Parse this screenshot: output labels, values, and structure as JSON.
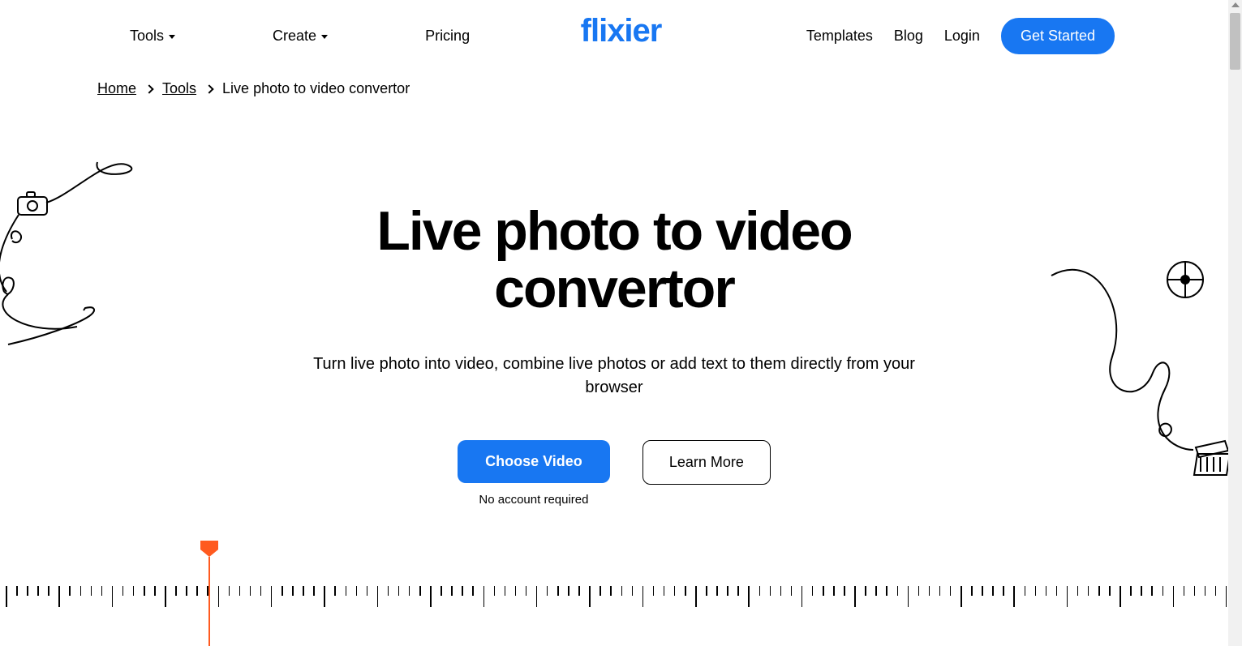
{
  "nav": {
    "left": [
      {
        "label": "Tools",
        "dropdown": true
      },
      {
        "label": "Create",
        "dropdown": true
      },
      {
        "label": "Pricing",
        "dropdown": false
      }
    ],
    "logo": "flixier",
    "right": {
      "templates": "Templates",
      "blog": "Blog",
      "login": "Login",
      "cta": "Get Started"
    }
  },
  "breadcrumb": {
    "items": [
      {
        "label": "Home",
        "link": true
      },
      {
        "label": "Tools",
        "link": true
      },
      {
        "label": "Live photo to video convertor",
        "link": false
      }
    ]
  },
  "hero": {
    "title": "Live photo to video convertor",
    "subtitle": "Turn live photo into video, combine live photos or add text to them directly from your browser",
    "choose_label": "Choose Video",
    "choose_note": "No account required",
    "learn_label": "Learn More"
  }
}
